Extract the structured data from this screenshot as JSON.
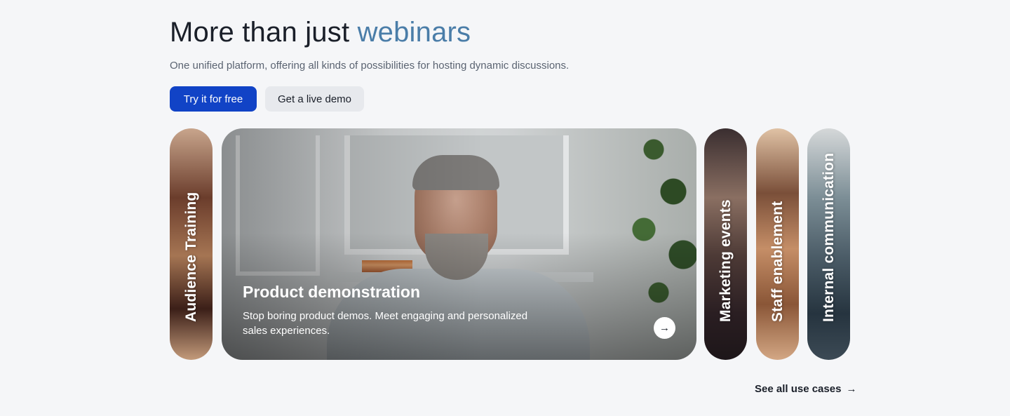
{
  "hero": {
    "title_main": "More than just ",
    "title_accent": "webinars",
    "subtitle": "One unified platform, offering all kinds of possibilities for hosting dynamic discussions.",
    "primary_cta": "Try it for free",
    "secondary_cta": "Get a live demo"
  },
  "use_cases": {
    "active": {
      "title": "Product demonstration",
      "description": "Stop boring product demos. Meet engaging and personalized sales experiences.",
      "arrow_icon": "arrow-right-icon"
    },
    "collapsed": [
      {
        "label": "Audience Training"
      },
      {
        "label": "Marketing events"
      },
      {
        "label": "Staff enablement"
      },
      {
        "label": "Internal communication"
      }
    ]
  },
  "footer_link": {
    "label": "See all use cases",
    "icon": "arrow-right-icon"
  },
  "colors": {
    "background": "#f5f6f8",
    "accent_text": "#4a7da8",
    "primary_button": "#1143c6",
    "secondary_button": "#e7e9ed"
  }
}
